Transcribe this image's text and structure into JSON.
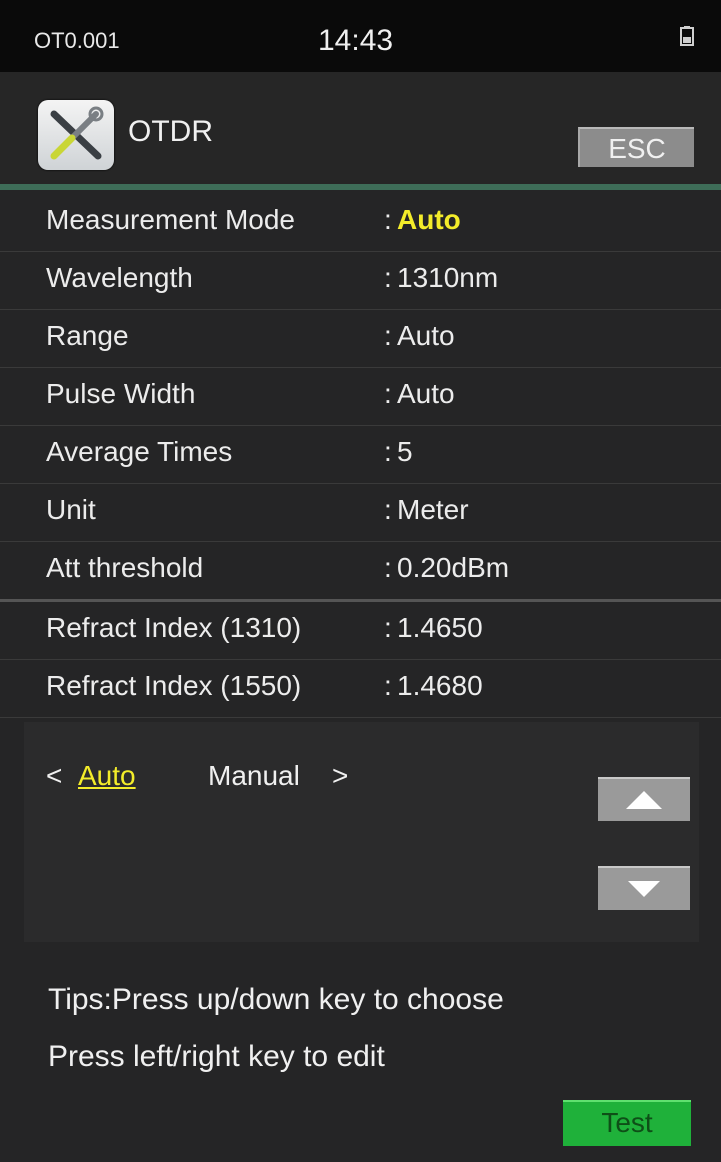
{
  "status_bar": {
    "device_id": "OT0.001",
    "time": "14:43",
    "battery_icon": "battery-icon"
  },
  "header": {
    "app_icon": "tools-icon",
    "title": "OTDR",
    "esc_label": "ESC"
  },
  "settings": [
    {
      "label": "Measurement Mode",
      "value": "Auto",
      "selected": true
    },
    {
      "label": "Wavelength",
      "value": "1310nm"
    },
    {
      "label": "Range",
      "value": "Auto"
    },
    {
      "label": "Pulse Width",
      "value": "Auto"
    },
    {
      "label": "Average Times",
      "value": "5"
    },
    {
      "label": "Unit",
      "value": "Meter"
    },
    {
      "label": "Att threshold",
      "value": "0.20dBm"
    },
    {
      "label": "Refract Index (1310)",
      "value": "1.4650"
    },
    {
      "label": "Refract Index (1550)",
      "value": "1.4680"
    }
  ],
  "options": {
    "left_marker": "<",
    "selected": "Auto",
    "other": "Manual",
    "right_marker": ">"
  },
  "tips": {
    "line1": "Tips:Press up/down key to choose",
    "line2": "Press left/right key to edit"
  },
  "actions": {
    "test_label": "Test"
  },
  "colors": {
    "highlight": "#f3ec2a",
    "divider": "#3e6d58",
    "test_button": "#1fb13a"
  }
}
